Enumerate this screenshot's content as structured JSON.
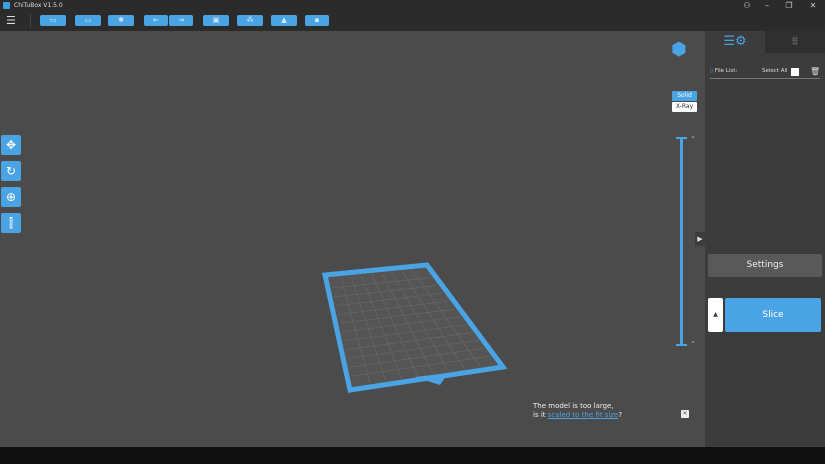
{
  "app": {
    "title": "ChiTuBox V1.5.0"
  },
  "toolbar": {
    "buttons": [
      {
        "name": "open-file",
        "icon": "folder-icon",
        "glyph": "▭"
      },
      {
        "name": "save",
        "icon": "save-icon",
        "glyph": "▭"
      },
      {
        "name": "repair",
        "icon": "repair-icon",
        "glyph": "✱"
      },
      {
        "name": "import",
        "icon": "import-icon",
        "glyph": "⇤"
      },
      {
        "name": "export",
        "icon": "export-icon",
        "glyph": "⇥"
      },
      {
        "name": "copy",
        "icon": "copy-icon",
        "glyph": "▣"
      },
      {
        "name": "supports",
        "icon": "supports-icon",
        "glyph": "⁂"
      },
      {
        "name": "hollow",
        "icon": "hollow-icon",
        "glyph": "▲"
      },
      {
        "name": "fill",
        "icon": "fill-icon",
        "glyph": "▪"
      }
    ]
  },
  "left_tools": [
    {
      "name": "move",
      "glyph": "✥"
    },
    {
      "name": "rotate",
      "glyph": "↻"
    },
    {
      "name": "scale",
      "glyph": "⊕"
    },
    {
      "name": "mirror",
      "glyph": "⫿"
    }
  ],
  "view": {
    "solid": "Solid",
    "xray": "X-Ray"
  },
  "panel": {
    "file_list": "File List:",
    "select_all": "Select All",
    "settings": "Settings",
    "slice": "Slice"
  },
  "notice": {
    "line1": "The model is too large,",
    "prefix": "is it ",
    "link": "scaled to the fit size",
    "suffix": "?"
  },
  "colors": {
    "accent": "#4aa3e2",
    "background": "#4b4b4b",
    "panel": "#3c3c3c"
  }
}
